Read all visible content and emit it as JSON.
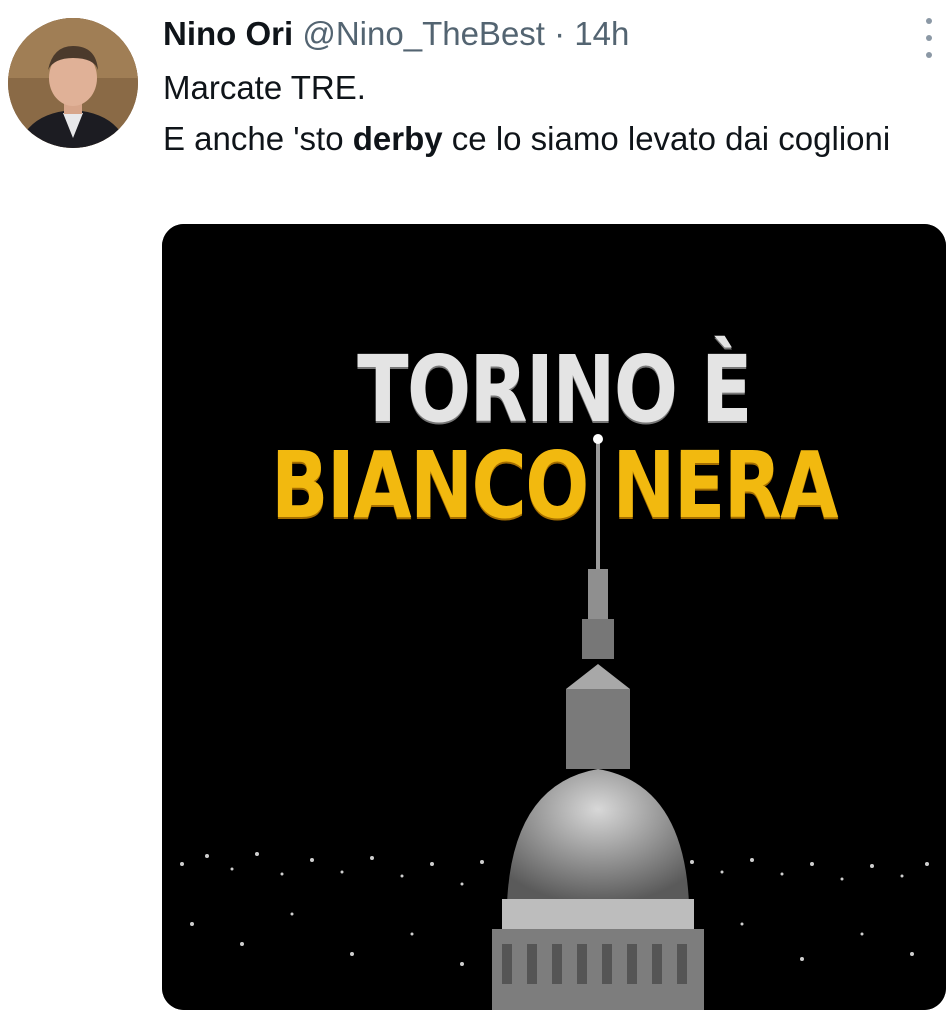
{
  "tweet": {
    "author_name": "Nino Ori",
    "handle": "@Nino_TheBest",
    "separator": "·",
    "time": "14h",
    "line1": "Marcate TRE.",
    "line2_pre": "E anche 'sto ",
    "line2_bold": "derby",
    "line2_post": " ce lo siamo levato dai coglioni",
    "media": {
      "title_line1": "TORINO È",
      "title_line2": "BIANCO NERA"
    }
  },
  "colors": {
    "text": "#0f1419",
    "secondary": "#536471",
    "media_title_white": "#e4e4e4",
    "media_title_yellow": "#f2b90f"
  },
  "icons": {
    "more": "more-icon"
  }
}
